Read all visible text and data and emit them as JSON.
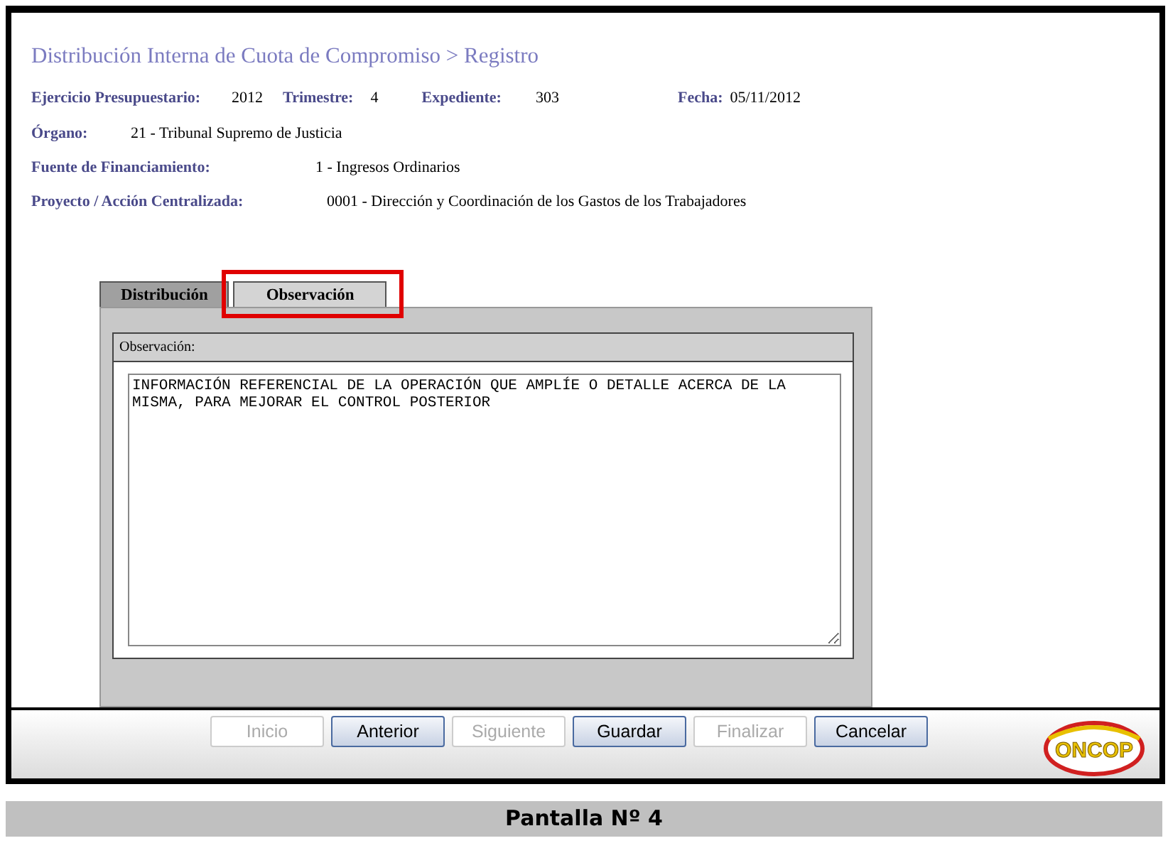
{
  "page_title": "Distribución Interna de Cuota de Compromiso > Registro",
  "header_fields": [
    {
      "label": "Ejercicio Presupuestario:",
      "value": "2012"
    },
    {
      "label": "Trimestre:",
      "value": "4"
    },
    {
      "label": "Expediente:",
      "value": "303"
    },
    {
      "label": "Fecha:",
      "value": "05/11/2012"
    }
  ],
  "detail_fields": [
    {
      "label": "Órgano:",
      "value": "21 - Tribunal Supremo de Justicia"
    },
    {
      "label": "Fuente de Financiamiento:",
      "value": "1 - Ingresos Ordinarios"
    },
    {
      "label": "Proyecto / Acción Centralizada:",
      "value": "0001 - Dirección y Coordinación de los Gastos de los Trabajadores"
    }
  ],
  "tabs": [
    {
      "label": "Distribución",
      "selected": false,
      "highlighted": false
    },
    {
      "label": "Observación",
      "selected": true,
      "highlighted": true
    }
  ],
  "observation": {
    "heading": "Observación:",
    "value": "INFORMACIÓN REFERENCIAL DE LA OPERACIÓN QUE AMPLÍE O DETALLE ACERCA DE LA MISMA, PARA MEJORAR EL CONTROL POSTERIOR"
  },
  "buttons": [
    {
      "label": "Inicio",
      "disabled": true
    },
    {
      "label": "Anterior",
      "disabled": false
    },
    {
      "label": "Siguiente",
      "disabled": true
    },
    {
      "label": "Guardar",
      "disabled": false
    },
    {
      "label": "Finalizar",
      "disabled": true
    },
    {
      "label": "Cancelar",
      "disabled": false
    }
  ],
  "logo": {
    "text": "ONCOP"
  },
  "caption": "Pantalla Nº 4"
}
